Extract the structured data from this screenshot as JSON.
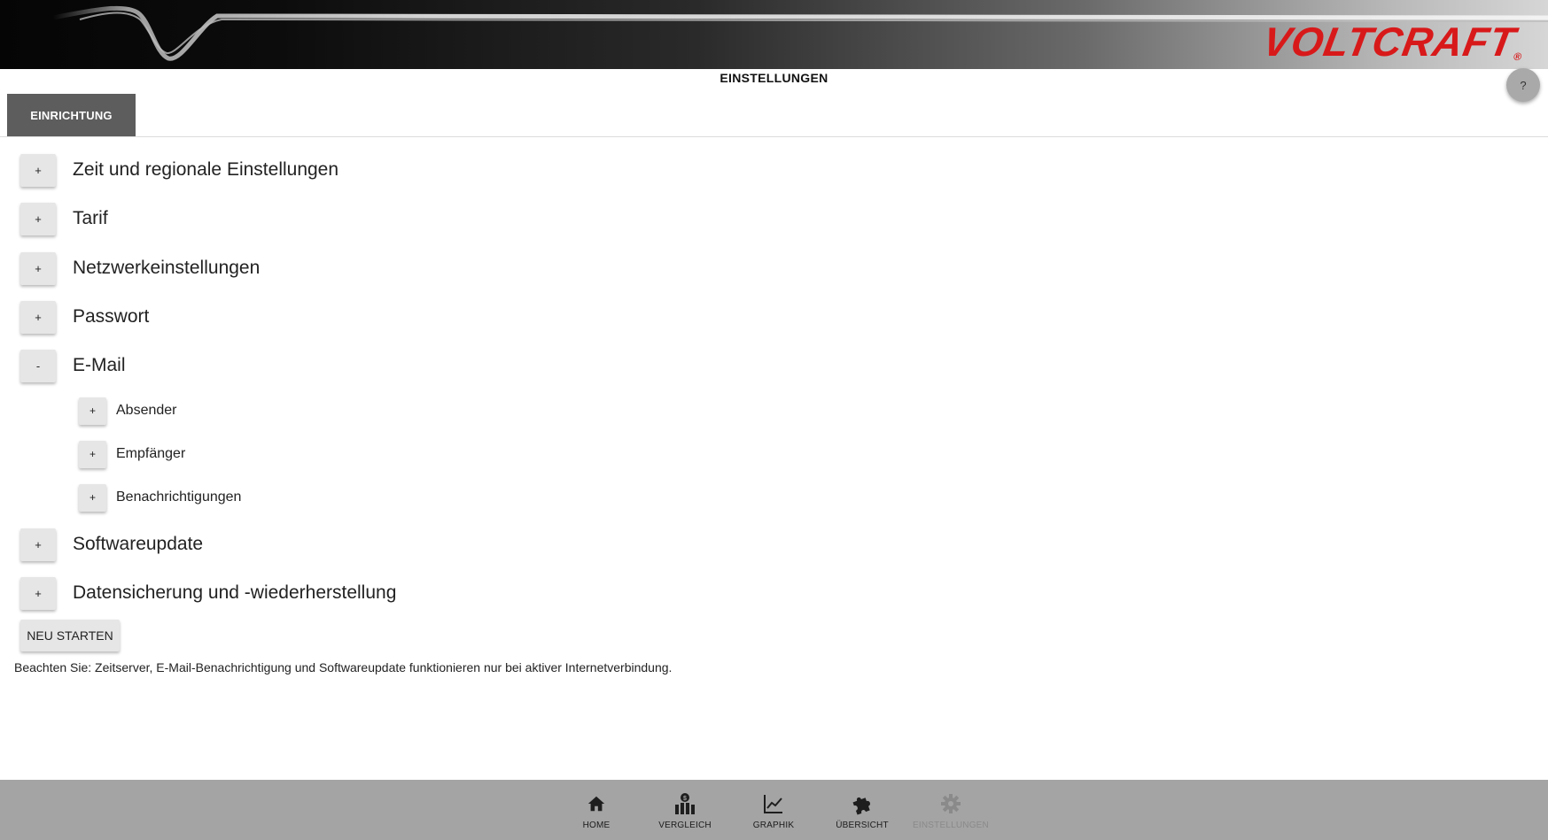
{
  "header": {
    "brand": "VOLTCRAFT",
    "brand_mark": "®",
    "page_title": "EINSTELLUNGEN",
    "help_label": "?"
  },
  "tabs": [
    {
      "label": "EINRICHTUNG",
      "active": true
    }
  ],
  "sections": [
    {
      "toggle": "+",
      "label": "Zeit und regionale Einstellungen"
    },
    {
      "toggle": "+",
      "label": "Tarif"
    },
    {
      "toggle": "+",
      "label": "Netzwerkeinstellungen"
    },
    {
      "toggle": "+",
      "label": "Passwort"
    },
    {
      "toggle": "-",
      "label": "E-Mail"
    },
    {
      "toggle": "+",
      "label": "Softwareupdate"
    },
    {
      "toggle": "+",
      "label": "Datensicherung und -wiederherstellung"
    }
  ],
  "email_subsections": [
    {
      "toggle": "+",
      "label": "Absender"
    },
    {
      "toggle": "+",
      "label": "Empfänger"
    },
    {
      "toggle": "+",
      "label": "Benachrichtigungen"
    }
  ],
  "actions": {
    "restart_label": "NEU STARTEN"
  },
  "note": "Beachten Sie: Zeitserver, E-Mail-Benachrichtigung und Softwareupdate funktionieren nur bei aktiver Internetverbindung.",
  "bottom_nav": [
    {
      "label": "HOME",
      "icon": "home-icon"
    },
    {
      "label": "VERGLEICH",
      "icon": "comparison-icon"
    },
    {
      "label": "GRAPHIK",
      "icon": "graph-icon"
    },
    {
      "label": "ÜBERSICHT",
      "icon": "puzzle-icon"
    },
    {
      "label": "EINSTELLUNGEN",
      "icon": "gear-icon",
      "disabled": true
    }
  ],
  "colors": {
    "brand_red": "#d8191a",
    "tab_active": "#5d5d5d",
    "nav_bar": "#a4a4a4",
    "button_gray": "#e6e6e6"
  }
}
